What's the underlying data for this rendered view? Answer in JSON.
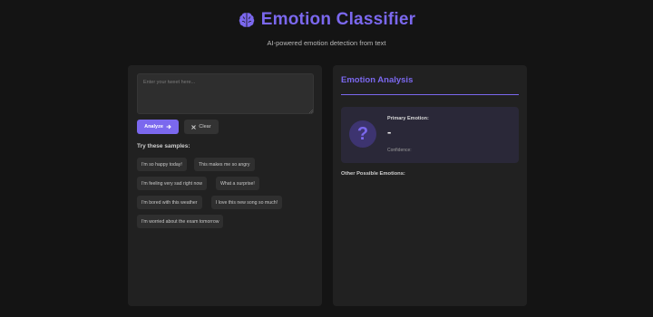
{
  "header": {
    "title": "Emotion Classifier",
    "subtitle": "AI-powered emotion detection from text",
    "icon": "brain-icon"
  },
  "input_panel": {
    "placeholder": "Enter your tweet here...",
    "value": "",
    "analyze_label": "Analyze",
    "clear_label": "Clear",
    "samples_heading": "Try these samples:",
    "samples": [
      "I'm so happy today!",
      "This makes me so angry",
      "I'm feeling very sad right now",
      "What a surprise!",
      "I'm bored with this weather",
      "I love this new song so much!",
      "I'm worried about the exam tomorrow"
    ]
  },
  "analysis_panel": {
    "title": "Emotion Analysis",
    "primary_label": "Primary Emotion:",
    "primary_value": "-",
    "confidence_label": "Confidence:",
    "other_heading": "Other Possible Emotions:"
  },
  "colors": {
    "accent": "#7b68ee",
    "background": "#141414",
    "panel": "#212121"
  }
}
